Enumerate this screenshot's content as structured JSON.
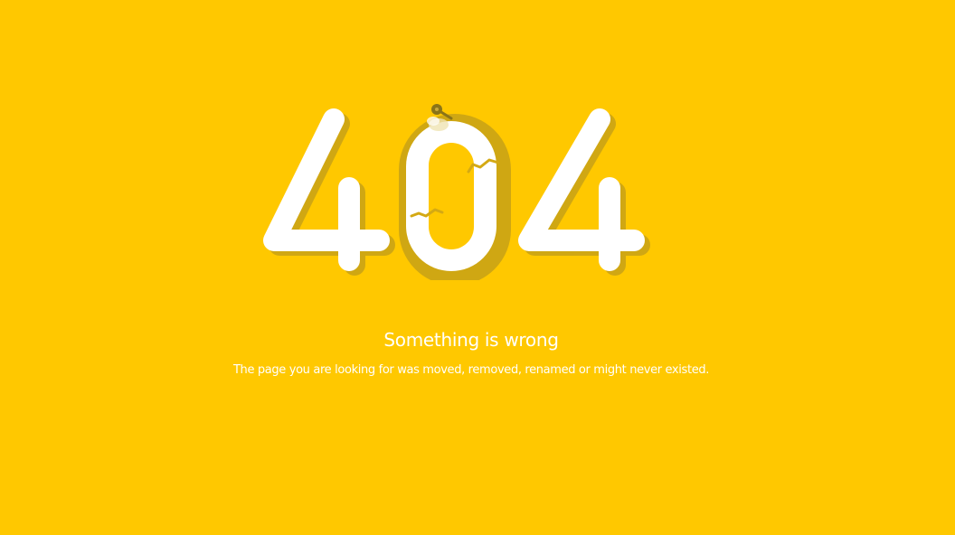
{
  "error": {
    "code": "404",
    "title": "Something is wrong",
    "message": "The page you are looking for was moved, removed, renamed or might never existed."
  },
  "colors": {
    "background": "#FFC800",
    "digit_fill": "#FFFFFF",
    "digit_shadow": "#C09C1A",
    "pin": "#8A7418",
    "text": "#FFFFFF"
  },
  "icons": {
    "graphic": "broken-zero-404-illustration",
    "pin": "pushpin-icon"
  }
}
